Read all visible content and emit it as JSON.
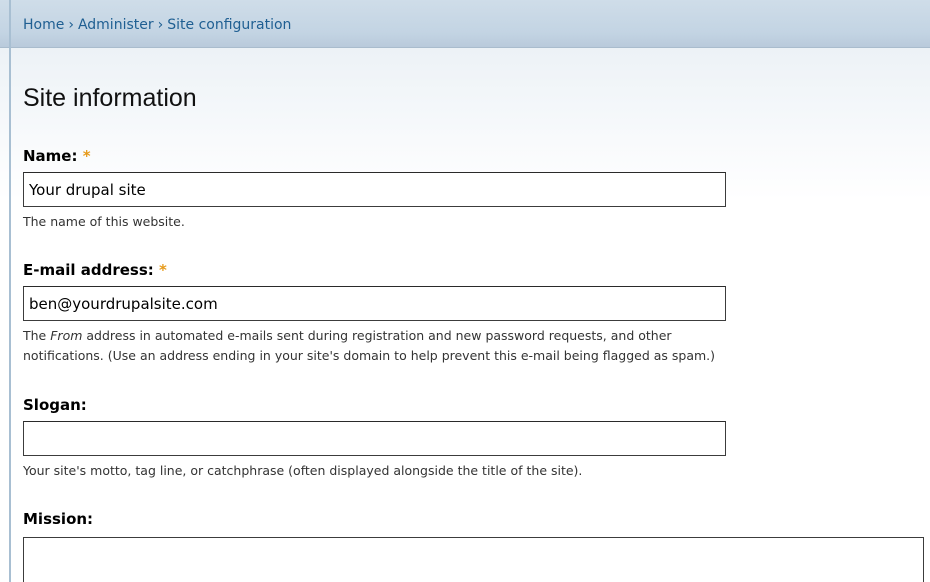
{
  "breadcrumb": {
    "items": [
      "Home",
      "Administer",
      "Site configuration"
    ],
    "separator": "›"
  },
  "page_title": "Site information",
  "required_marker": "*",
  "fields": {
    "name": {
      "label": "Name:",
      "value": "Your drupal site",
      "description": "The name of this website."
    },
    "email": {
      "label": "E-mail address:",
      "value": "ben@yourdrupalsite.com",
      "description_prefix": "The ",
      "description_em": "From",
      "description_line1_rest": " address in automated e-mails sent during registration and new password requests, and other",
      "description_line2": "notifications. (Use an address ending in your site's domain to help prevent this e-mail being flagged as spam.)"
    },
    "slogan": {
      "label": "Slogan:",
      "value": "",
      "description": "Your site's motto, tag line, or catchphrase (often displayed alongside the title of the site)."
    },
    "mission": {
      "label": "Mission:",
      "value": ""
    }
  },
  "colors": {
    "link": "#1f5f92",
    "required": "#e69a1a",
    "header_bar": "#c3d4e3"
  }
}
